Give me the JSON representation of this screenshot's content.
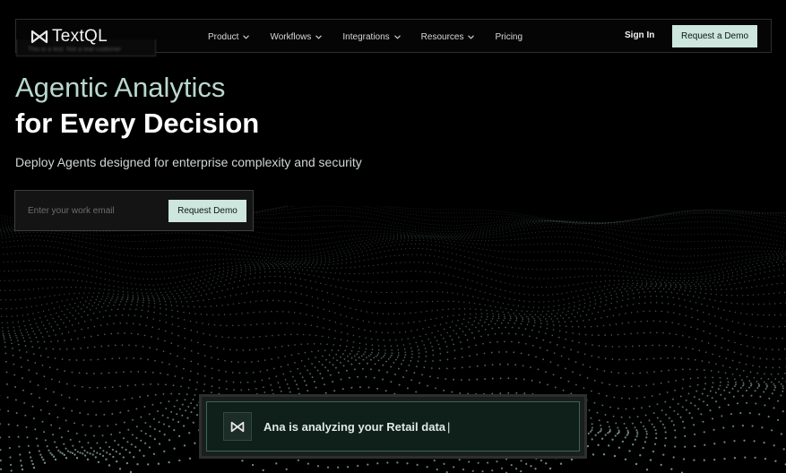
{
  "brand": {
    "name": "TextQL",
    "logo_icon": "textql-logo-icon",
    "blurred_badge": "This is a test. Not a real customer"
  },
  "nav": {
    "items": [
      {
        "label": "Product",
        "has_dropdown": true
      },
      {
        "label": "Workflows",
        "has_dropdown": true
      },
      {
        "label": "Integrations",
        "has_dropdown": true
      },
      {
        "label": "Resources",
        "has_dropdown": true
      },
      {
        "label": "Pricing",
        "has_dropdown": false
      }
    ],
    "sign_in": "Sign In",
    "cta": "Request a Demo"
  },
  "hero": {
    "line1": "Agentic Analytics",
    "line2": "for Every Decision",
    "subtitle": "Deploy Agents designed for enterprise complexity and security"
  },
  "email_form": {
    "placeholder": "Enter your work email",
    "button": "Request Demo"
  },
  "agent_status": {
    "icon": "textql-logo-icon",
    "text": "Ana is analyzing your Retail data",
    "cursor": "|"
  },
  "colors": {
    "accent": "#cde6de",
    "hero_line1": "#b9d8cd",
    "card_bg": "#0e2019",
    "card_border": "#3a6558",
    "wave_dots": "#8fb3a6"
  }
}
